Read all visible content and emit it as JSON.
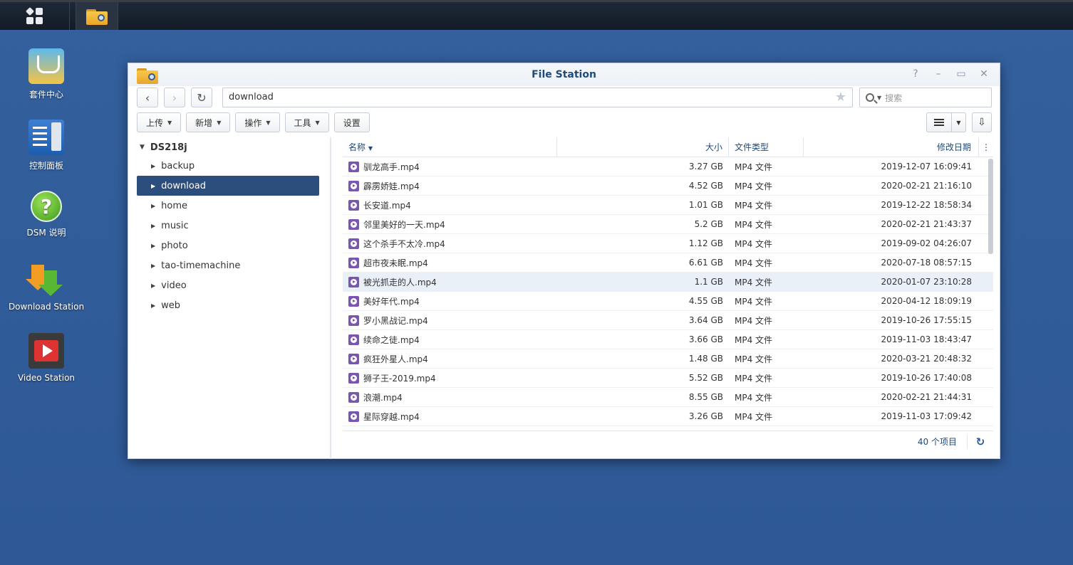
{
  "taskbar": {
    "main_menu_icon": "grid-menu-icon",
    "file_station_icon": "folder-search-icon"
  },
  "desktop": {
    "icons": [
      {
        "label": "套件中心",
        "icon": "package-center-icon"
      },
      {
        "label": "控制面板",
        "icon": "control-panel-icon"
      },
      {
        "label": "DSM 说明",
        "icon": "help-icon"
      },
      {
        "label": "Download Station",
        "icon": "download-station-icon"
      },
      {
        "label": "Video Station",
        "icon": "video-station-icon"
      }
    ]
  },
  "window": {
    "title": "File Station",
    "controls": {
      "help": "?",
      "minimize": "–",
      "maximize": "▭",
      "close": "✕"
    },
    "nav": {
      "back": "‹",
      "forward": "›",
      "refresh": "↻",
      "path": "download",
      "star": "★",
      "search_placeholder": "搜索"
    },
    "toolbar": {
      "upload": "上传",
      "create": "新增",
      "action": "操作",
      "tools": "工具",
      "settings": "设置"
    },
    "tree": {
      "root": "DS218j",
      "items": [
        "backup",
        "download",
        "home",
        "music",
        "photo",
        "tao-timemachine",
        "video",
        "web"
      ],
      "selected": "download"
    },
    "grid": {
      "headers": {
        "name": "名称",
        "size": "大小",
        "type": "文件类型",
        "modified": "修改日期"
      },
      "rows": [
        {
          "name": "驯龙高手.mp4",
          "size": "3.27 GB",
          "type": "MP4 文件",
          "modified": "2019-12-07 16:09:41"
        },
        {
          "name": "霹雳娇娃.mp4",
          "size": "4.52 GB",
          "type": "MP4 文件",
          "modified": "2020-02-21 21:16:10"
        },
        {
          "name": "长安道.mp4",
          "size": "1.01 GB",
          "type": "MP4 文件",
          "modified": "2019-12-22 18:58:34"
        },
        {
          "name": "邻里美好的一天.mp4",
          "size": "5.2 GB",
          "type": "MP4 文件",
          "modified": "2020-02-21 21:43:37"
        },
        {
          "name": "这个杀手不太冷.mp4",
          "size": "1.12 GB",
          "type": "MP4 文件",
          "modified": "2019-09-02 04:26:07"
        },
        {
          "name": "超市夜未眠.mp4",
          "size": "6.61 GB",
          "type": "MP4 文件",
          "modified": "2020-07-18 08:57:15"
        },
        {
          "name": "被光抓走的人.mp4",
          "size": "1.1 GB",
          "type": "MP4 文件",
          "modified": "2020-01-07 23:10:28"
        },
        {
          "name": "美好年代.mp4",
          "size": "4.55 GB",
          "type": "MP4 文件",
          "modified": "2020-04-12 18:09:19"
        },
        {
          "name": "罗小黑战记.mp4",
          "size": "3.64 GB",
          "type": "MP4 文件",
          "modified": "2019-10-26 17:55:15"
        },
        {
          "name": "续命之徒.mp4",
          "size": "3.66 GB",
          "type": "MP4 文件",
          "modified": "2019-11-03 18:43:47"
        },
        {
          "name": "疯狂外星人.mp4",
          "size": "1.48 GB",
          "type": "MP4 文件",
          "modified": "2020-03-21 20:48:32"
        },
        {
          "name": "狮子王-2019.mp4",
          "size": "5.52 GB",
          "type": "MP4 文件",
          "modified": "2019-10-26 17:40:08"
        },
        {
          "name": "浪潮.mp4",
          "size": "8.55 GB",
          "type": "MP4 文件",
          "modified": "2020-02-21 21:44:31"
        },
        {
          "name": "星际穿越.mp4",
          "size": "3.26 GB",
          "type": "MP4 文件",
          "modified": "2019-11-03 17:09:42"
        }
      ],
      "selected_row": 6
    },
    "status": {
      "count": "40 个项目",
      "refresh": "↻"
    }
  },
  "colors": {
    "desktop": "#2f5b99",
    "selection": "#2c4e7c",
    "accent": "#1e4a7c",
    "video_icon": "#7b55b2"
  }
}
